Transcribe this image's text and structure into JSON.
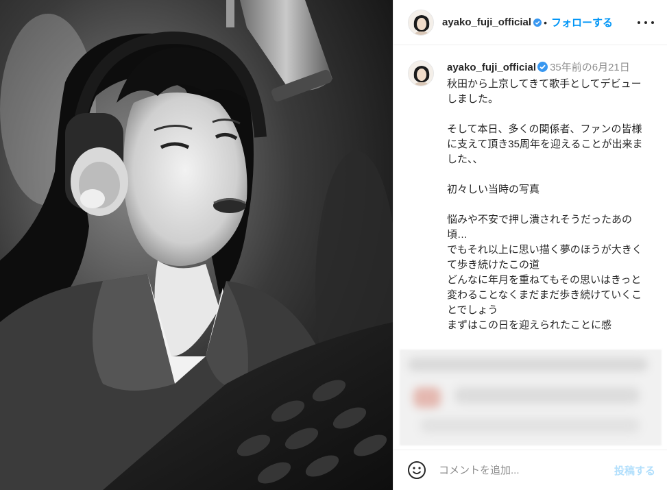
{
  "post": {
    "username": "ayako_fuji_official",
    "follow_label": "フォローする",
    "dot": "•",
    "caption_time": "35年前の6月21日",
    "caption_body": "秋田から上京してきて歌手としてデビューしました。\n\nそして本日、多くの関係者、ファンの皆様に支えて頂き35周年を迎えることが出来ました、、\n\n初々しい当時の写真\n\n悩みや不安で押し潰されそうだったあの頃…\nでもそれ以上に思い描く夢のほうが大きくて歩き続けたこの道\nどんなに年月を重ねてもその思いはきっと変わることなくまだまだ歩き続けていくことでしょう\nまずはこの日を迎えられたことに感"
  },
  "comment_box": {
    "placeholder": "コメントを追加...",
    "post_label": "投稿する"
  },
  "icons": {
    "verified": "verified-badge-icon",
    "more": "more-options-icon",
    "emoji": "emoji-icon"
  },
  "colors": {
    "accent": "#0095f6",
    "post_disabled": "#b2dffc",
    "muted": "#8e8e8e"
  }
}
